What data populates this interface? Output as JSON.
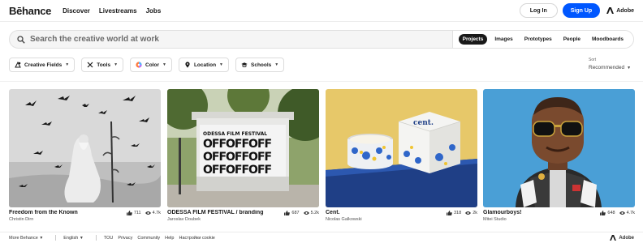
{
  "header": {
    "logo": "Bēhance",
    "nav": [
      "Discover",
      "Livestreams",
      "Jobs"
    ],
    "login": "Log In",
    "signup": "Sign Up",
    "adobe": "Adobe"
  },
  "search": {
    "placeholder": "Search the creative world at work",
    "tabs": [
      "Projects",
      "Images",
      "Prototypes",
      "People",
      "Moodboards"
    ],
    "active_tab": "Projects"
  },
  "filters": {
    "items": [
      "Creative Fields",
      "Tools",
      "Color",
      "Location",
      "Schools"
    ],
    "sort_label": "Sort",
    "sort_value": "Recommended"
  },
  "projects": [
    {
      "title": "Freedom from the Known",
      "owner": "Christin Dirn",
      "likes": "711",
      "views": "4.7k"
    },
    {
      "title": "ODESSA FILM FESTIVAL / branding",
      "owner": "Jaroslav Doubek",
      "likes": "687",
      "views": "5.2k"
    },
    {
      "title": "Cent.",
      "owner": "Nicolas Galkowski",
      "likes": "318",
      "views": "2k"
    },
    {
      "title": "Glamourboys!",
      "owner": "Mitei Studio",
      "likes": "648",
      "views": "4.7k"
    }
  ],
  "thumb_text": {
    "festival": "ODESSA FILM FESTIVAL",
    "cent": "cent."
  },
  "footer": {
    "more": "More Behance",
    "lang": "English",
    "links": [
      "TOU",
      "Privacy",
      "Community",
      "Help",
      "Настройки cookie"
    ],
    "adobe": "Adobe"
  },
  "colors": {
    "brand_blue": "#0057ff",
    "text": "#191919"
  }
}
